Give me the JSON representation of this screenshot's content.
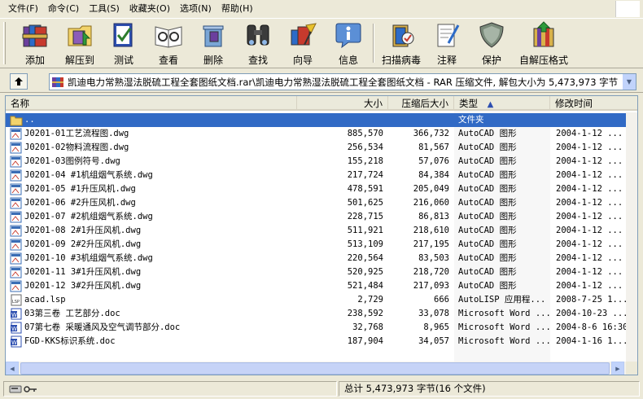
{
  "menu": [
    {
      "label": "文件(F)"
    },
    {
      "label": "命令(C)"
    },
    {
      "label": "工具(S)"
    },
    {
      "label": "收藏夹(O)"
    },
    {
      "label": "选项(N)"
    },
    {
      "label": "帮助(H)"
    }
  ],
  "toolbar": [
    {
      "label": "添加",
      "icon": "add-archive-icon"
    },
    {
      "label": "解压到",
      "icon": "extract-to-icon"
    },
    {
      "label": "测试",
      "icon": "test-icon"
    },
    {
      "label": "查看",
      "icon": "view-icon"
    },
    {
      "label": "删除",
      "icon": "delete-icon"
    },
    {
      "label": "查找",
      "icon": "find-icon"
    },
    {
      "label": "向导",
      "icon": "wizard-icon"
    },
    {
      "label": "信息",
      "icon": "info-icon"
    },
    {
      "label": "扫描病毒",
      "icon": "virus-scan-icon"
    },
    {
      "label": "注释",
      "icon": "comment-icon"
    },
    {
      "label": "保护",
      "icon": "protect-icon"
    },
    {
      "label": "自解压格式",
      "icon": "sfx-icon"
    }
  ],
  "address": {
    "text": "凯迪电力常熟湿法脱硫工程全套图纸文档.rar\\凯迪电力常熟湿法脱硫工程全套图纸文档 - RAR 压缩文件, 解包大小为 5,473,973 字节"
  },
  "columns": {
    "name": "名称",
    "size": "大小",
    "packed": "压缩后大小",
    "type": "类型",
    "modified": "修改时间"
  },
  "files": [
    {
      "name": "..",
      "size": "",
      "packed": "",
      "type": "文件夹",
      "modified": "",
      "kind": "folder",
      "selected": true
    },
    {
      "name": "J0201-01工艺流程图.dwg",
      "size": "885,570",
      "packed": "366,732",
      "type": "AutoCAD 图形",
      "modified": "2004-1-12 ...",
      "kind": "dwg"
    },
    {
      "name": "J0201-02物料流程图.dwg",
      "size": "256,534",
      "packed": "81,567",
      "type": "AutoCAD 图形",
      "modified": "2004-1-12 ...",
      "kind": "dwg"
    },
    {
      "name": "J0201-03图例符号.dwg",
      "size": "155,218",
      "packed": "57,076",
      "type": "AutoCAD 图形",
      "modified": "2004-1-12 ...",
      "kind": "dwg"
    },
    {
      "name": "J0201-04 #1机组烟气系统.dwg",
      "size": "217,724",
      "packed": "84,384",
      "type": "AutoCAD 图形",
      "modified": "2004-1-12 ...",
      "kind": "dwg"
    },
    {
      "name": "J0201-05 #1升压风机.dwg",
      "size": "478,591",
      "packed": "205,049",
      "type": "AutoCAD 图形",
      "modified": "2004-1-12 ...",
      "kind": "dwg"
    },
    {
      "name": "J0201-06 #2升压风机.dwg",
      "size": "501,625",
      "packed": "216,060",
      "type": "AutoCAD 图形",
      "modified": "2004-1-12 ...",
      "kind": "dwg"
    },
    {
      "name": "J0201-07 #2机组烟气系统.dwg",
      "size": "228,715",
      "packed": "86,813",
      "type": "AutoCAD 图形",
      "modified": "2004-1-12 ...",
      "kind": "dwg"
    },
    {
      "name": "J0201-08 2#1升压风机.dwg",
      "size": "511,921",
      "packed": "218,610",
      "type": "AutoCAD 图形",
      "modified": "2004-1-12 ...",
      "kind": "dwg"
    },
    {
      "name": "J0201-09 2#2升压风机.dwg",
      "size": "513,109",
      "packed": "217,195",
      "type": "AutoCAD 图形",
      "modified": "2004-1-12 ...",
      "kind": "dwg"
    },
    {
      "name": "J0201-10 #3机组烟气系统.dwg",
      "size": "220,564",
      "packed": "83,503",
      "type": "AutoCAD 图形",
      "modified": "2004-1-12 ...",
      "kind": "dwg"
    },
    {
      "name": "J0201-11 3#1升压风机.dwg",
      "size": "520,925",
      "packed": "218,720",
      "type": "AutoCAD 图形",
      "modified": "2004-1-12 ...",
      "kind": "dwg"
    },
    {
      "name": "J0201-12 3#2升压风机.dwg",
      "size": "521,484",
      "packed": "217,093",
      "type": "AutoCAD 图形",
      "modified": "2004-1-12 ...",
      "kind": "dwg"
    },
    {
      "name": "acad.lsp",
      "size": "2,729",
      "packed": "666",
      "type": "AutoLISP 应用程...",
      "modified": "2008-7-25 1...",
      "kind": "lsp"
    },
    {
      "name": "03第三卷 工艺部分.doc",
      "size": "238,592",
      "packed": "33,078",
      "type": "Microsoft Word ...",
      "modified": "2004-10-23 ...",
      "kind": "doc"
    },
    {
      "name": "07第七卷 采暖通风及空气调节部分.doc",
      "size": "32,768",
      "packed": "8,965",
      "type": "Microsoft Word ...",
      "modified": "2004-8-6 16:30",
      "kind": "doc"
    },
    {
      "name": "FGD-KKS标识系统.doc",
      "size": "187,904",
      "packed": "34,057",
      "type": "Microsoft Word ...",
      "modified": "2004-1-16 1...",
      "kind": "doc"
    }
  ],
  "status": {
    "summary": "总计 5,473,973 字节(16 个文件)"
  }
}
